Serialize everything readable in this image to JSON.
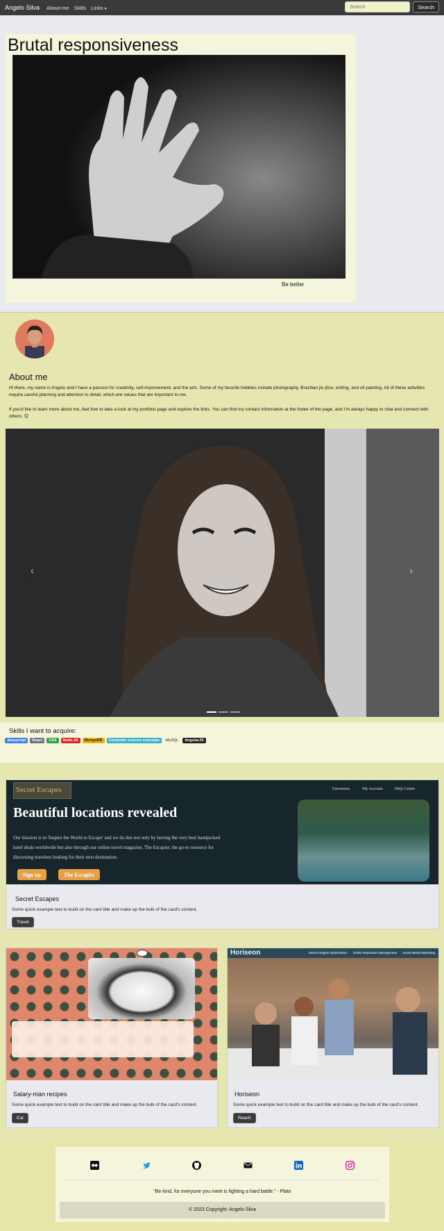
{
  "navbar": {
    "brand": "Angelo Silva",
    "links": [
      "About-me",
      "Skills",
      "Links"
    ],
    "search_placeholder": "Search",
    "search_button": "Search"
  },
  "hero": {
    "title": "Brutal responsiveness",
    "caption": "Be better"
  },
  "about": {
    "title": "About me",
    "paragraph1": "Hi there, my name is Angelo and I have a passion for creativity, self-improvement, and the arts. Some of my favorite hobbies include photography, Brazilian jiu-jitsu, writing, and oil painting. All of these activities require careful planning and attention to detail, which are values that are important to me.",
    "paragraph2": "If you'd like to learn more about me, feel free to take a look at my portfolio page and explore the links. You can find my contact information at the footer of the page, and I'm always happy to chat and connect with others. 😊"
  },
  "carousel": {
    "prev_icon": "chevron-left",
    "next_icon": "chevron-right",
    "slides": 3,
    "active": 1
  },
  "skills": {
    "title": "Skills I want to acquire:",
    "badges": [
      {
        "label": "Javascript",
        "color": "#3b82f6"
      },
      {
        "label": "React",
        "color": "#6b7280"
      },
      {
        "label": "CSS",
        "color": "#22a34a"
      },
      {
        "label": "Node.JS",
        "color": "#dc2626"
      },
      {
        "label": "MongoDB",
        "color": "#eab308"
      },
      {
        "label": "Computer science concepts",
        "color": "#38b2c8"
      },
      {
        "label": "MySQL",
        "color": "#e6e6b0"
      },
      {
        "label": "AngularJS",
        "color": "#222222"
      }
    ]
  },
  "cards": {
    "escapes": {
      "mock_logo": "Secret Escapes",
      "mock_nav": [
        "Favourites",
        "My Account",
        "Help Centre"
      ],
      "mock_heading": "Beautiful locations revealed",
      "mock_text": "Our mission is to 'Inspire the World to Escape' and we do this not only by having the very best handpicked hotel deals worldwide but also through our online travel magazine, The Escapist; the go-to resource for discerning travelers looking for their next destination.",
      "mock_btn1": "Sign up",
      "mock_btn2": "The Escapist",
      "title": "Secret Escapes",
      "text": "Some quick example text to build on the card title and make up the bulk of the card's content.",
      "button": "Travel"
    },
    "recipes": {
      "title": "Salary-man recipes",
      "text": "Some quick example text to build on the card title and make up the bulk of the card's content.",
      "button": "Eat"
    },
    "horiseon": {
      "mock_logo": "Horiseon",
      "mock_nav": [
        "Search Engine Optimization",
        "Online Reputation Management",
        "Social Media Marketing"
      ],
      "title": "Horiseon",
      "text": "Some quick example text to build on the card title and make up the bulk of the card's content.",
      "button": "Reach"
    }
  },
  "footer": {
    "social_icons": [
      "flickr-icon",
      "twitter-icon",
      "github-icon",
      "mail-icon",
      "linkedin-icon",
      "instagram-icon"
    ],
    "quote": "\"Be kind, for everyone you meet is fighting a hard battle.\" - Plato",
    "copyright": "© 2023 Copyright: Angelo Silva"
  }
}
